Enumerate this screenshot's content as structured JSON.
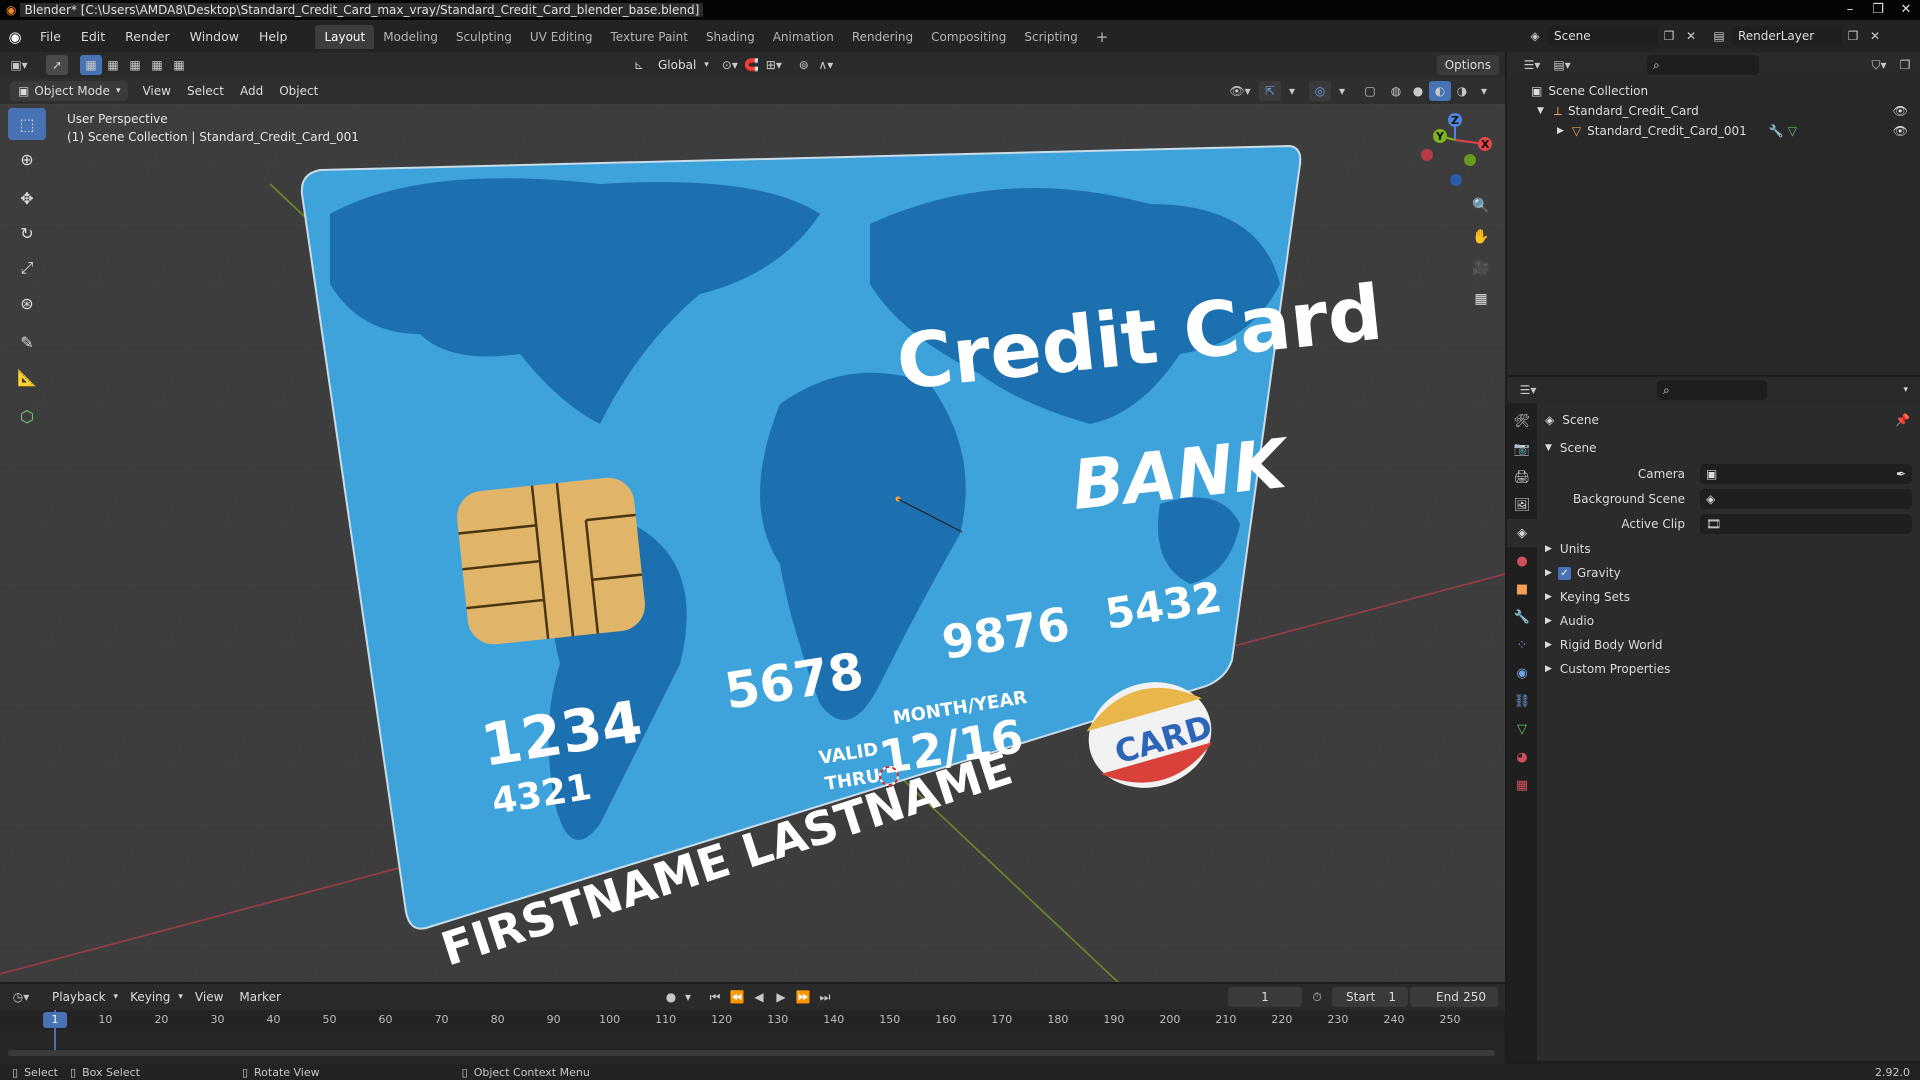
{
  "window": {
    "title": "Blender* [C:\\Users\\AMDA8\\Desktop\\Standard_Credit_Card_max_vray/Standard_Credit_Card_blender_base.blend]",
    "minimize": "–",
    "maximize": "❐",
    "close": "✕"
  },
  "menu": [
    "File",
    "Edit",
    "Render",
    "Window",
    "Help"
  ],
  "workspaces": [
    "Layout",
    "Modeling",
    "Sculpting",
    "UV Editing",
    "Texture Paint",
    "Shading",
    "Animation",
    "Rendering",
    "Compositing",
    "Scripting"
  ],
  "add_workspace": "+",
  "scene_field": "Scene",
  "render_layer_field": "RenderLayer",
  "header": {
    "transform_orientation": "Global",
    "options": "Options",
    "mode": "Object Mode",
    "view": "View",
    "select": "Select",
    "add": "Add",
    "object": "Object"
  },
  "viewport": {
    "perspective": "User Perspective",
    "collection_info": "(1) Scene Collection | Standard_Credit_Card_001",
    "gizmo": {
      "x": "X",
      "y": "Y",
      "z": "Z"
    }
  },
  "card": {
    "title": "Credit Card",
    "bank": "BANK",
    "num1": "1234",
    "num2": "5678",
    "num3": "9876",
    "num4": "5432",
    "small_num": "4321",
    "valid": "VALID",
    "thru": "THRU",
    "month_year": "MONTH/YEAR",
    "expiry": "12/16",
    "logo": "CARD",
    "holder": "FIRSTNAME LASTNAME"
  },
  "outliner": {
    "root": "Scene Collection",
    "item1": "Standard_Credit_Card",
    "item2": "Standard_Credit_Card_001"
  },
  "properties": {
    "context": "Scene",
    "panel": "Scene",
    "camera_label": "Camera",
    "bg_scene_label": "Background Scene",
    "active_clip_label": "Active Clip",
    "sections": [
      "Units",
      "Gravity",
      "Keying Sets",
      "Audio",
      "Rigid Body World",
      "Custom Properties"
    ],
    "gravity_checked": true
  },
  "timeline": {
    "playback": "Playback",
    "keying": "Keying",
    "view": "View",
    "marker": "Marker",
    "current_frame": "1",
    "start_label": "Start",
    "start": "1",
    "end_label": "End",
    "end": "250",
    "ticks": [
      "1",
      "10",
      "20",
      "30",
      "40",
      "50",
      "60",
      "70",
      "80",
      "90",
      "100",
      "110",
      "120",
      "130",
      "140",
      "150",
      "160",
      "170",
      "180",
      "190",
      "200",
      "210",
      "220",
      "230",
      "240",
      "250"
    ]
  },
  "status": {
    "select": "Select",
    "box_select": "Box Select",
    "rotate_view": "Rotate View",
    "context_menu": "Object Context Menu",
    "version": "2.92.0"
  },
  "colors": {
    "accent": "#4772b3",
    "card_light": "#3fa3d9",
    "card_dark": "#1b6faf",
    "chip": "#e0b56a"
  }
}
